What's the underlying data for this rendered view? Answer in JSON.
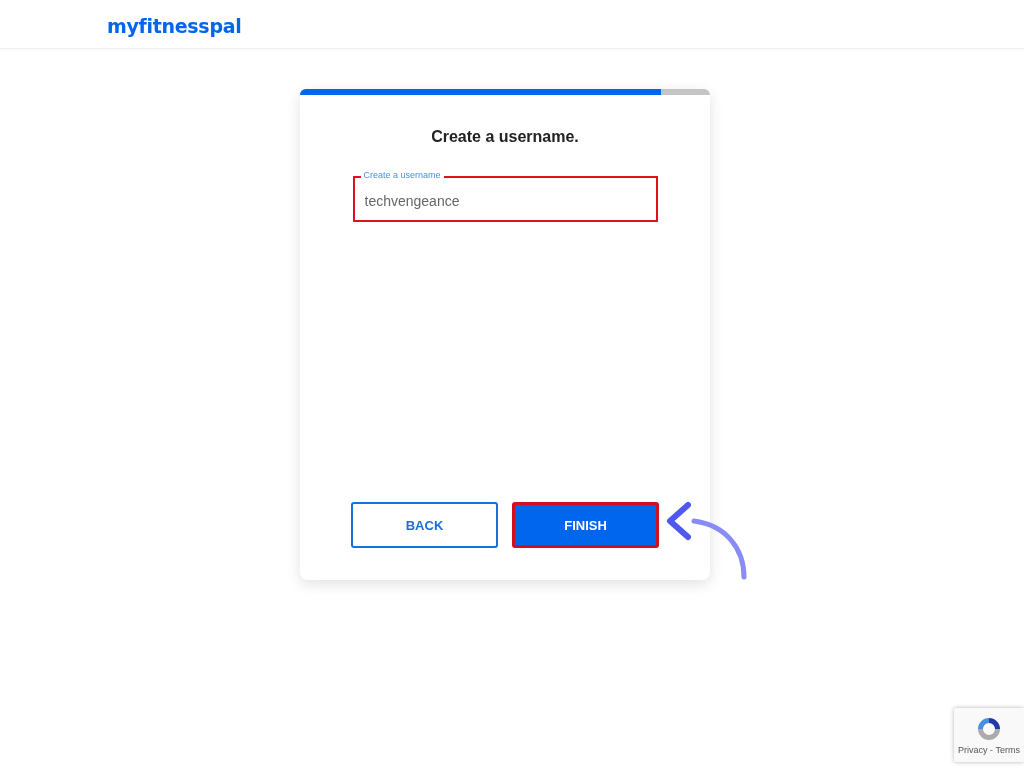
{
  "header": {
    "logo": "myfitnesspal"
  },
  "progress": {
    "level": 0.88
  },
  "card": {
    "title": "Create a username.",
    "field": {
      "label": "Create a username",
      "value": "techvengeance",
      "highlighted": true
    },
    "buttons": [
      {
        "label": "BACK",
        "kind": "secondary",
        "highlighted": false
      },
      {
        "label": "FINISH",
        "kind": "primary",
        "highlighted": true
      }
    ]
  },
  "recaptcha": {
    "text": "Privacy - Terms"
  }
}
